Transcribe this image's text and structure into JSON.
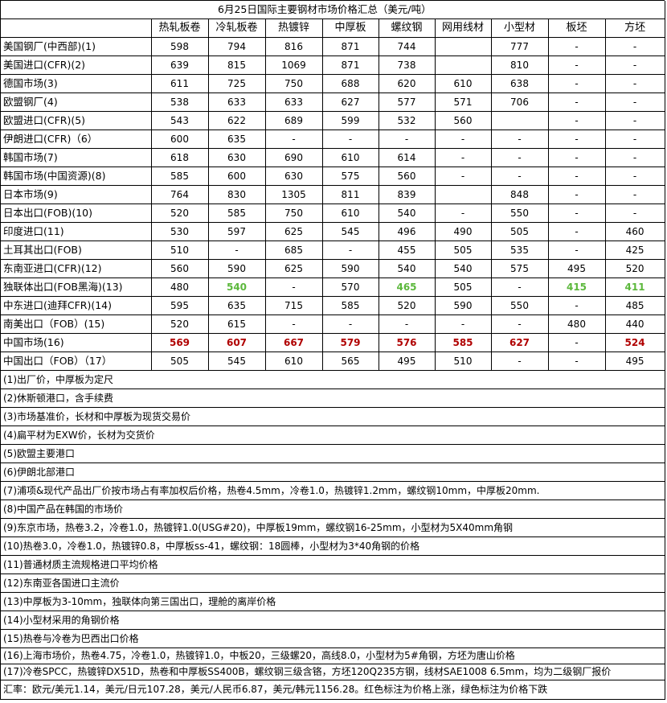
{
  "title": "6月25日国际主要钢材市场价格汇总（美元/吨）",
  "columns": [
    "热轧板卷",
    "冷轧板卷",
    "热镀锌",
    "中厚板",
    "螺纹钢",
    "网用线材",
    "小型材",
    "板坯",
    "方坯"
  ],
  "colors": {
    "up": "#b00000",
    "down": "#5cb83c"
  },
  "rows": [
    {
      "label": "美国钢厂(中西部)(1)",
      "values": [
        "598",
        "794",
        "816",
        "871",
        "744",
        "",
        "777",
        "-",
        "-"
      ],
      "status": [
        "",
        "",
        "",
        "",
        "",
        "",
        "",
        "",
        ""
      ]
    },
    {
      "label": "美国进口(CFR)(2)",
      "values": [
        "639",
        "815",
        "1069",
        "871",
        "738",
        "",
        "810",
        "-",
        "-"
      ],
      "status": [
        "",
        "",
        "",
        "",
        "",
        "",
        "",
        "",
        ""
      ]
    },
    {
      "label": "德国市场(3)",
      "values": [
        "611",
        "725",
        "750",
        "688",
        "620",
        "610",
        "638",
        "-",
        "-"
      ],
      "status": [
        "",
        "",
        "",
        "",
        "",
        "",
        "",
        "",
        ""
      ]
    },
    {
      "label": "欧盟钢厂(4)",
      "values": [
        "538",
        "633",
        "633",
        "627",
        "577",
        "571",
        "706",
        "-",
        "-"
      ],
      "status": [
        "",
        "",
        "",
        "",
        "",
        "",
        "",
        "",
        ""
      ]
    },
    {
      "label": "欧盟进口(CFR)(5)",
      "values": [
        "543",
        "622",
        "689",
        "599",
        "532",
        "560",
        "",
        "-",
        "-"
      ],
      "status": [
        "",
        "",
        "",
        "",
        "",
        "",
        "",
        "",
        ""
      ]
    },
    {
      "label": "伊朗进口(CFR)（6）",
      "values": [
        "600",
        "635",
        "-",
        "-",
        "-",
        "-",
        "-",
        "-",
        "-"
      ],
      "status": [
        "",
        "",
        "",
        "",
        "",
        "",
        "",
        "",
        ""
      ]
    },
    {
      "label": "韩国市场(7)",
      "values": [
        "618",
        "630",
        "690",
        "610",
        "614",
        "-",
        "-",
        "-",
        "-"
      ],
      "status": [
        "",
        "",
        "",
        "",
        "",
        "",
        "",
        "",
        ""
      ]
    },
    {
      "label": "韩国市场(中国资源)(8)",
      "values": [
        "585",
        "600",
        "630",
        "575",
        "560",
        "-",
        "-",
        "-",
        "-"
      ],
      "status": [
        "",
        "",
        "",
        "",
        "",
        "",
        "",
        "",
        ""
      ]
    },
    {
      "label": "日本市场(9)",
      "values": [
        "764",
        "830",
        "1305",
        "811",
        "839",
        "",
        "848",
        "-",
        "-"
      ],
      "status": [
        "",
        "",
        "",
        "",
        "",
        "",
        "",
        "",
        ""
      ]
    },
    {
      "label": "日本出口(FOB)(10)",
      "values": [
        "520",
        "585",
        "750",
        "610",
        "540",
        "-",
        "550",
        "-",
        "-"
      ],
      "status": [
        "",
        "",
        "",
        "",
        "",
        "",
        "",
        "",
        ""
      ]
    },
    {
      "label": "印度进口(11)",
      "values": [
        "530",
        "597",
        "625",
        "545",
        "496",
        "490",
        "505",
        "-",
        "460"
      ],
      "status": [
        "",
        "",
        "",
        "",
        "",
        "",
        "",
        "",
        ""
      ]
    },
    {
      "label": "土耳其出口(FOB)",
      "values": [
        "510",
        "-",
        "685",
        "-",
        "455",
        "505",
        "535",
        "-",
        "425"
      ],
      "status": [
        "",
        "",
        "",
        "",
        "",
        "",
        "",
        "",
        ""
      ]
    },
    {
      "label": "东南亚进口(CFR)(12)",
      "values": [
        "560",
        "590",
        "625",
        "590",
        "540",
        "540",
        "575",
        "495",
        "520"
      ],
      "status": [
        "",
        "",
        "",
        "",
        "",
        "",
        "",
        "",
        ""
      ]
    },
    {
      "label": "独联体出口(FOB黑海)(13)",
      "values": [
        "480",
        "540",
        "-",
        "570",
        "465",
        "505",
        "-",
        "415",
        "411"
      ],
      "status": [
        "",
        "down",
        "",
        "",
        "down",
        "",
        "",
        "down",
        "down"
      ]
    },
    {
      "label": "中东进口(迪拜CFR)(14)",
      "values": [
        "595",
        "635",
        "715",
        "585",
        "520",
        "590",
        "550",
        "-",
        "485"
      ],
      "status": [
        "",
        "",
        "",
        "",
        "",
        "",
        "",
        "",
        ""
      ]
    },
    {
      "label": "南美出口（FOB）(15)",
      "values": [
        "520",
        "615",
        "-",
        "-",
        "-",
        "-",
        "-",
        "480",
        "440"
      ],
      "status": [
        "",
        "",
        "",
        "",
        "",
        "",
        "",
        "",
        ""
      ]
    },
    {
      "label": "中国市场(16)",
      "values": [
        "569",
        "607",
        "667",
        "579",
        "576",
        "585",
        "627",
        "-",
        "524"
      ],
      "status": [
        "up",
        "up",
        "up",
        "up",
        "up",
        "up",
        "up",
        "",
        "up"
      ]
    },
    {
      "label": "中国出口（FOB）（17）",
      "values": [
        "505",
        "545",
        "610",
        "565",
        "495",
        "510",
        "-",
        "-",
        "495"
      ],
      "status": [
        "",
        "",
        "",
        "",
        "",
        "",
        "",
        "",
        ""
      ]
    }
  ],
  "notes": [
    "(1)出厂价，中厚板为定尺",
    "(2)休斯顿港口，含手续费",
    "(3)市场基准价，长材和中厚板为现货交易价",
    "(4)扁平材为EXW价，长材为交货价",
    "(5)欧盟主要港口",
    "(6)伊朗北部港口",
    "(7)浦项&现代产品出厂价按市场占有率加权后价格，热卷4.5mm，冷卷1.0，热镀锌1.2mm，螺纹钢10mm，中厚板20mm.",
    "(8)中国产品在韩国的市场价",
    "(9)东京市场，热卷3.2，冷卷1.0，热镀锌1.0(USG#20)，中厚板19mm，螺纹钢16-25mm，小型材为5X40mm角钢",
    "(10)热卷3.0，冷卷1.0，热镀锌0.8，中厚板ss-41，螺纹钢：18圆棒，小型材为3*40角钢的价格",
    "(11)普通材质主流规格进口平均价格",
    "(12)东南亚各国进口主流价",
    "(13)中厚板为3-10mm，独联体向第三国出口，理舱的离岸价格",
    "(14)小型材采用的角钢价格",
    "(15)热卷与冷卷为巴西出口价格",
    "(16)上海市场价，热卷4.75，冷卷1.0，热镀锌1.0，中板20，三级螺20，高线8.0，小型材为5#角钢，方坯为唐山价格",
    "(17)冷卷SPCC，热镀锌DX51D，热卷和中厚板SS400B，螺纹钢三级含铬，方坯120Q235方钢，线材SAE1008 6.5mm，均为二级钢厂报价"
  ],
  "exchange_note": "汇率：欧元/美元1.14，美元/日元107.28，美元/人民币6.87，美元/韩元1156.28。红色标注为价格上涨，绿色标注为价格下跌"
}
